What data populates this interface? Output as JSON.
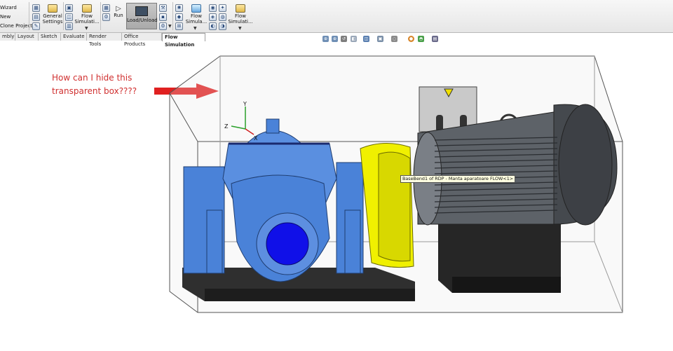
{
  "ribbon": {
    "left_items": [
      "Wizard",
      "New",
      "Clone Project"
    ],
    "general_settings": "General Settings",
    "flow_simulation_1": "Flow Simulati...",
    "run": "Run",
    "load_unload": "Load/Unload",
    "flow_simulation_2": "Flow Simula...",
    "flow_simulation_3": "Flow Simulati..."
  },
  "tabs": [
    {
      "label": "mbly",
      "active": false
    },
    {
      "label": "Layout",
      "active": false
    },
    {
      "label": "Sketch",
      "active": false
    },
    {
      "label": "Evaluate",
      "active": false
    },
    {
      "label": "Render Tools",
      "active": false
    },
    {
      "label": "Office Products",
      "active": false
    },
    {
      "label": "Flow Simulation",
      "active": true
    }
  ],
  "annotation": {
    "line1": "How can I hide this",
    "line2": "transparent box????",
    "color": "#d03030"
  },
  "tooltip": "BaseBend1 of RDP - Manta aparatoare FLOW<1>",
  "triad": {
    "x": "X",
    "y": "Y",
    "z": "Z"
  },
  "colors": {
    "pump": "#4a82d8",
    "guard": "#f0f000",
    "motor": "#5d6268",
    "base": "#2f2f2f",
    "annotation_arrow": "#e02020"
  },
  "icons": [
    "zoom-fit-icon",
    "zoom-area-icon",
    "previous-view-icon",
    "section-view-icon",
    "view-orientation-icon",
    "display-style-icon",
    "hide-show-icon",
    "edit-appearance-icon",
    "scene-icon",
    "view-settings-icon"
  ]
}
